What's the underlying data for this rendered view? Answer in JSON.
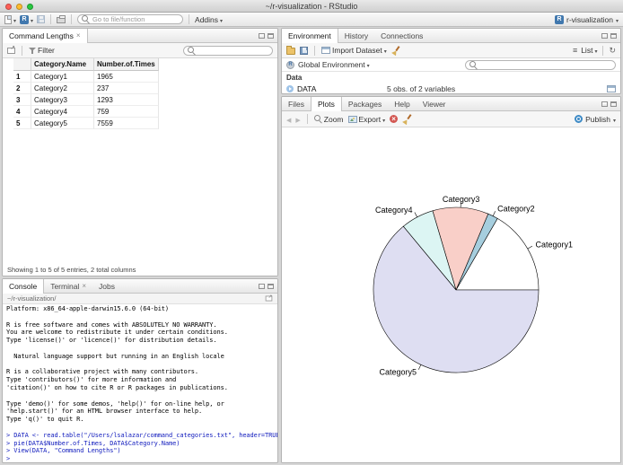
{
  "window": {
    "title": "~/r-visualization - RStudio"
  },
  "main_toolbar": {
    "goto_placeholder": "Go to file/function",
    "addins_label": "Addins",
    "project_label": "r-visualization"
  },
  "data_viewer": {
    "tab_label": "Command Lengths",
    "filter_label": "Filter",
    "columns": [
      "Category.Name",
      "Number.of.Times"
    ],
    "rows": [
      {
        "num": "1",
        "name": "Category1",
        "times": "1965"
      },
      {
        "num": "2",
        "name": "Category2",
        "times": "237"
      },
      {
        "num": "3",
        "name": "Category3",
        "times": "1293"
      },
      {
        "num": "4",
        "name": "Category4",
        "times": "759"
      },
      {
        "num": "5",
        "name": "Category5",
        "times": "7559"
      }
    ],
    "status": "Showing 1 to 5 of 5 entries, 2 total columns"
  },
  "console_pane": {
    "tabs": [
      "Console",
      "Terminal",
      "Jobs"
    ],
    "active_tab": "Console",
    "path": "~/r-visualization/",
    "lines": [
      {
        "text": "Platform: x86_64-apple-darwin15.6.0 (64-bit)",
        "type": "out"
      },
      {
        "text": "",
        "type": "out"
      },
      {
        "text": "R is free software and comes with ABSOLUTELY NO WARRANTY.",
        "type": "out"
      },
      {
        "text": "You are welcome to redistribute it under certain conditions.",
        "type": "out"
      },
      {
        "text": "Type 'license()' or 'licence()' for distribution details.",
        "type": "out"
      },
      {
        "text": "",
        "type": "out"
      },
      {
        "text": "  Natural language support but running in an English locale",
        "type": "out"
      },
      {
        "text": "",
        "type": "out"
      },
      {
        "text": "R is a collaborative project with many contributors.",
        "type": "out"
      },
      {
        "text": "Type 'contributors()' for more information and",
        "type": "out"
      },
      {
        "text": "'citation()' on how to cite R or R packages in publications.",
        "type": "out"
      },
      {
        "text": "",
        "type": "out"
      },
      {
        "text": "Type 'demo()' for some demos, 'help()' for on-line help, or",
        "type": "out"
      },
      {
        "text": "'help.start()' for an HTML browser interface to help.",
        "type": "out"
      },
      {
        "text": "Type 'q()' to quit R.",
        "type": "out"
      },
      {
        "text": "",
        "type": "out"
      },
      {
        "text": "> DATA <- read.table(\"/Users/lsalazar/command_categories.txt\", header=TRUE)",
        "type": "cmd"
      },
      {
        "text": "> pie(DATA$Number.of.Times, DATA$Category.Name)",
        "type": "cmd"
      },
      {
        "text": "> View(DATA, \"Command Lengths\")",
        "type": "cmd"
      },
      {
        "text": "> ",
        "type": "cmd"
      }
    ]
  },
  "environment_pane": {
    "tabs": [
      "Environment",
      "History",
      "Connections"
    ],
    "active_tab": "Environment",
    "import_label": "Import Dataset",
    "list_label": "List",
    "scope_label": "Global Environment",
    "section_label": "Data",
    "objects": [
      {
        "name": "DATA",
        "desc": "5 obs. of 2 variables"
      }
    ]
  },
  "plots_pane": {
    "tabs": [
      "Files",
      "Plots",
      "Packages",
      "Help",
      "Viewer"
    ],
    "active_tab": "Plots",
    "zoom_label": "Zoom",
    "export_label": "Export",
    "publish_label": "Publish"
  },
  "chart_data": {
    "type": "pie",
    "title": "",
    "categories": [
      "Category1",
      "Category2",
      "Category3",
      "Category4",
      "Category5"
    ],
    "values": [
      1965,
      237,
      1293,
      759,
      7559
    ],
    "colors": [
      "#FFFFFF",
      "#A6CEDE",
      "#F9CFC8",
      "#DCF5F3",
      "#DEDEF2"
    ],
    "start_angle_deg": 0,
    "direction": "counterclockwise",
    "legend": "labels-on-slices"
  }
}
